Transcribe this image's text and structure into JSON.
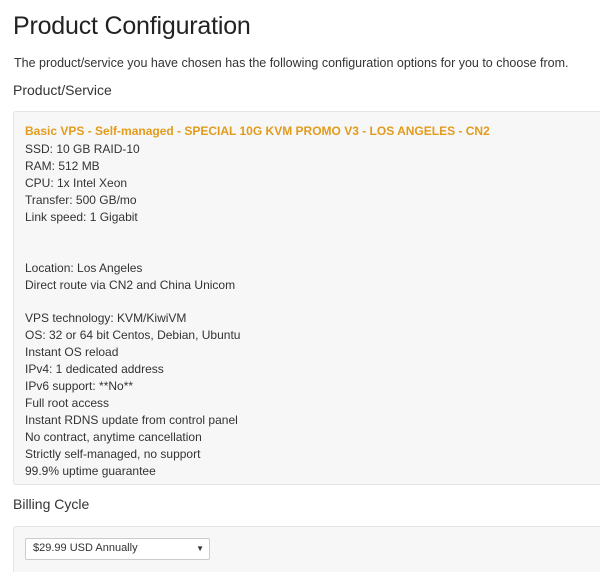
{
  "page": {
    "title": "Product Configuration",
    "intro": "The product/service you have chosen has the following configuration options for you to choose from."
  },
  "product_section": {
    "heading": "Product/Service",
    "name": "Basic VPS - Self-managed - SPECIAL 10G KVM PROMO V3 - LOS ANGELES - CN2",
    "specs": [
      "SSD: 10 GB RAID-10",
      "RAM: 512 MB",
      "CPU: 1x Intel Xeon",
      "Transfer: 500 GB/mo",
      "Link speed: 1 Gigabit",
      "Location: Los Angeles",
      "Direct route via CN2 and China Unicom",
      "VPS technology: KVM/KiwiVM",
      "OS: 32 or 64 bit Centos, Debian, Ubuntu",
      "Instant OS reload",
      "IPv4: 1 dedicated address",
      "IPv6 support: **No**",
      "Full root access",
      "Instant RDNS update from control panel",
      "No contract, anytime cancellation",
      "Strictly self-managed, no support",
      "99.9% uptime guarantee"
    ]
  },
  "billing_section": {
    "heading": "Billing Cycle",
    "selected_option": "$29.99 USD Annually",
    "caret_icon": "chevron-down-icon"
  },
  "colors": {
    "product_name": "#e39b1b",
    "panel_background": "#f7f7f7",
    "panel_border": "#e3e3e3",
    "text": "#333333"
  }
}
